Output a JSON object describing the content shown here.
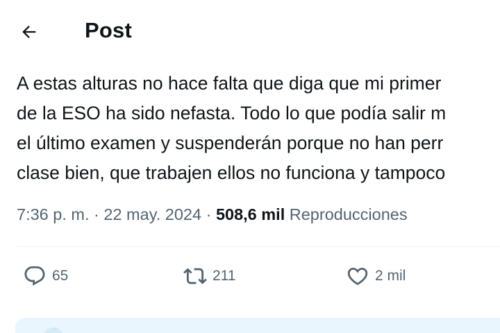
{
  "header": {
    "back_icon": "arrow-left-icon",
    "title": "Post"
  },
  "tweet": {
    "lines": [
      "A estas alturas no hace falta que diga que mi primer",
      "de la ESO ha sido nefasta. Todo lo que podía salir m",
      "el último examen y suspenderán porque no han perr",
      "clase bien, que trabajen ellos no funciona y tampoco"
    ],
    "time_date": "7:36 p. m. · 22 may. 2024 · ",
    "views_count": "508,6 mil",
    "views_label": "Reproducciones"
  },
  "actions": {
    "reply": {
      "icon": "reply-bubble-icon",
      "count": "65"
    },
    "retweet": {
      "icon": "retweet-icon",
      "count": "211"
    },
    "like": {
      "icon": "heart-icon",
      "count": "2 mil"
    }
  },
  "colors": {
    "text": "#0f1419",
    "secondary": "#536471",
    "divider": "#eff3f4",
    "banner_bg": "#eaf6fd"
  }
}
